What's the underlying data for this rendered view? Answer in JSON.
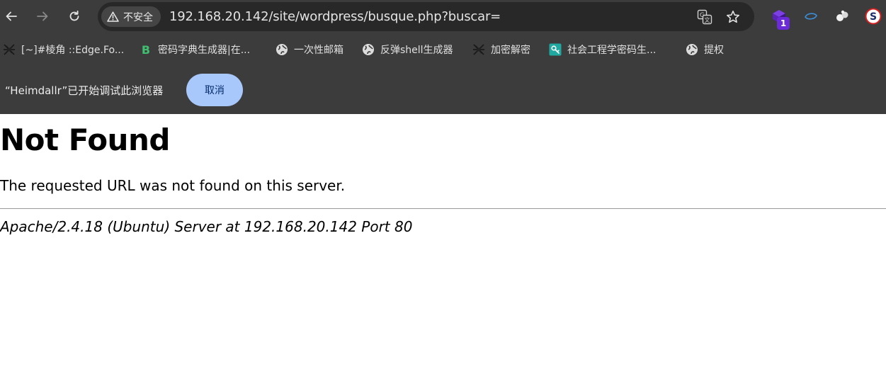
{
  "toolbar": {
    "security_label": "不安全",
    "url": "192.168.20.142/site/wordpress/busque.php?buscar=",
    "extension_badge": "1"
  },
  "bookmarks": [
    {
      "label": "[~]#棱角 ::Edge.Fo...",
      "icon": "spider-icon"
    },
    {
      "label": "密码字典生成器|在...",
      "icon": "b-logo-icon"
    },
    {
      "label": "一次性邮箱",
      "icon": "globe-icon"
    },
    {
      "label": "反弹shell生成器",
      "icon": "globe-icon"
    },
    {
      "label": "加密解密",
      "icon": "spider-icon"
    },
    {
      "label": "社会工程学密码生...",
      "icon": "key-icon"
    },
    {
      "label": "提权",
      "icon": "globe-icon"
    }
  ],
  "infobar": {
    "message": "“Heimdallr”已开始调试此浏览器",
    "cancel_label": "取消"
  },
  "page": {
    "title": "Not Found",
    "message": "The requested URL was not found on this server.",
    "address": "Apache/2.4.18 (Ubuntu) Server at 192.168.20.142 Port 80"
  },
  "colors": {
    "chrome_bg": "#3c3c3c",
    "omnibox_bg": "#282828",
    "cancel_button": "#a8c7fa",
    "badge": "#6b2bd6"
  }
}
